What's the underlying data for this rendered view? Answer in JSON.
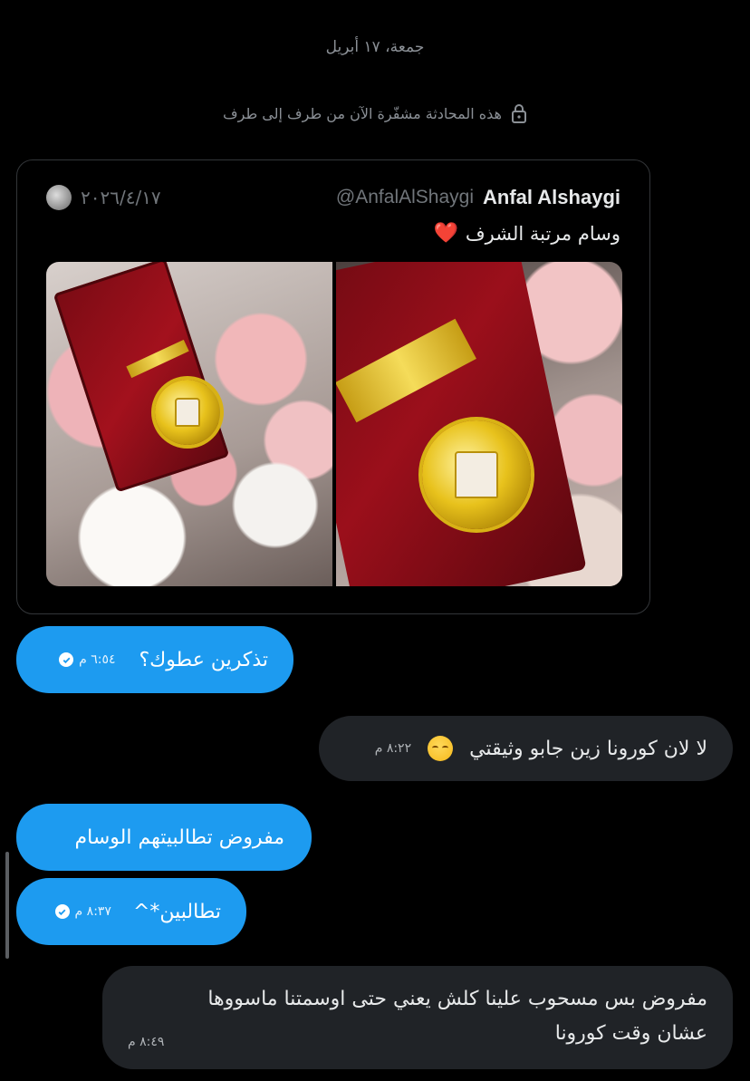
{
  "conversation": {
    "date_separator": "جمعة، ١٧ أبريل",
    "encryption_notice": "هذه المحادثة مشفّرة الآن من طرف إلى طرف",
    "encryption_icon": "lock-icon"
  },
  "tweet": {
    "author_name": "Anfal Alshaygi",
    "author_handle": "@AnfalAlShaygi",
    "date": "٢٠٢٦/٤/١٧",
    "text": "وسام مرتبة الشرف",
    "emoji": "❤️",
    "photos": [
      "medal-box-with-roses-photo",
      "medal-closeup-photo"
    ]
  },
  "messages": [
    {
      "direction": "sent",
      "text": "تذكرين عطوك؟",
      "time": "٦:٥٤ م",
      "status": "read"
    },
    {
      "direction": "received",
      "text": "لا لان كورونا زين جابو وثيقتي",
      "emoji": "😔",
      "time": "٨:٢٢ م"
    },
    {
      "direction": "sent",
      "text": "مفروض تطالبيتهم الوسام"
    },
    {
      "direction": "sent",
      "text": "تطالبين*^",
      "time": "٨:٣٧ م",
      "status": "read"
    },
    {
      "direction": "received",
      "lines": [
        "مفروض بس مسحوب علينا كلش يعني حتى اوسمتنا ماسووها",
        "عشان وقت كورونا"
      ],
      "time": "٨:٤٩ م"
    }
  ],
  "colors": {
    "background": "#000000",
    "sent_bubble": "#1d9bf0",
    "received_bubble": "#202327",
    "secondary_text": "#71767b"
  }
}
